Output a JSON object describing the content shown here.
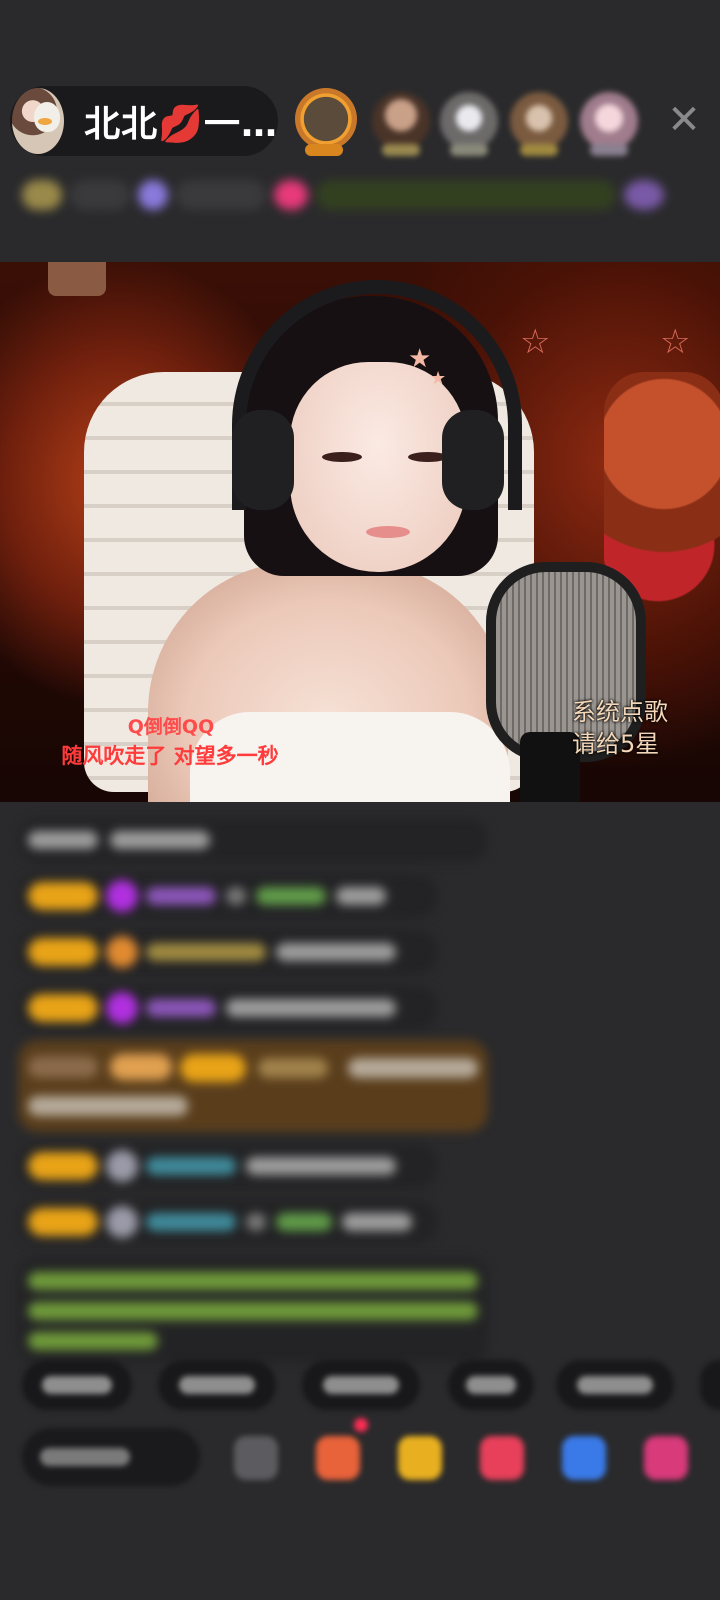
{
  "header": {
    "host_name": "北北💋一…",
    "close_symbol": "✕"
  },
  "video": {
    "lyric_line_1": "Q倒倒QQ",
    "lyric_line_2": "随风吹走了 对望多一秒",
    "song_request_line_1": "系统点歌",
    "song_request_line_2": "请给5星"
  },
  "colors": {
    "page_background": "#2a2a2c",
    "level_badge": "#e8a317",
    "lyric_red": "#ff3b3b",
    "song_note": "#f3d7b8"
  },
  "icons": {
    "close": "close-icon",
    "emoji": "emoji-icon",
    "gift_box": "gift-box-icon",
    "treasure": "treasure-icon",
    "heart": "heart-icon",
    "game": "game-icon",
    "more": "more-apps-icon"
  }
}
